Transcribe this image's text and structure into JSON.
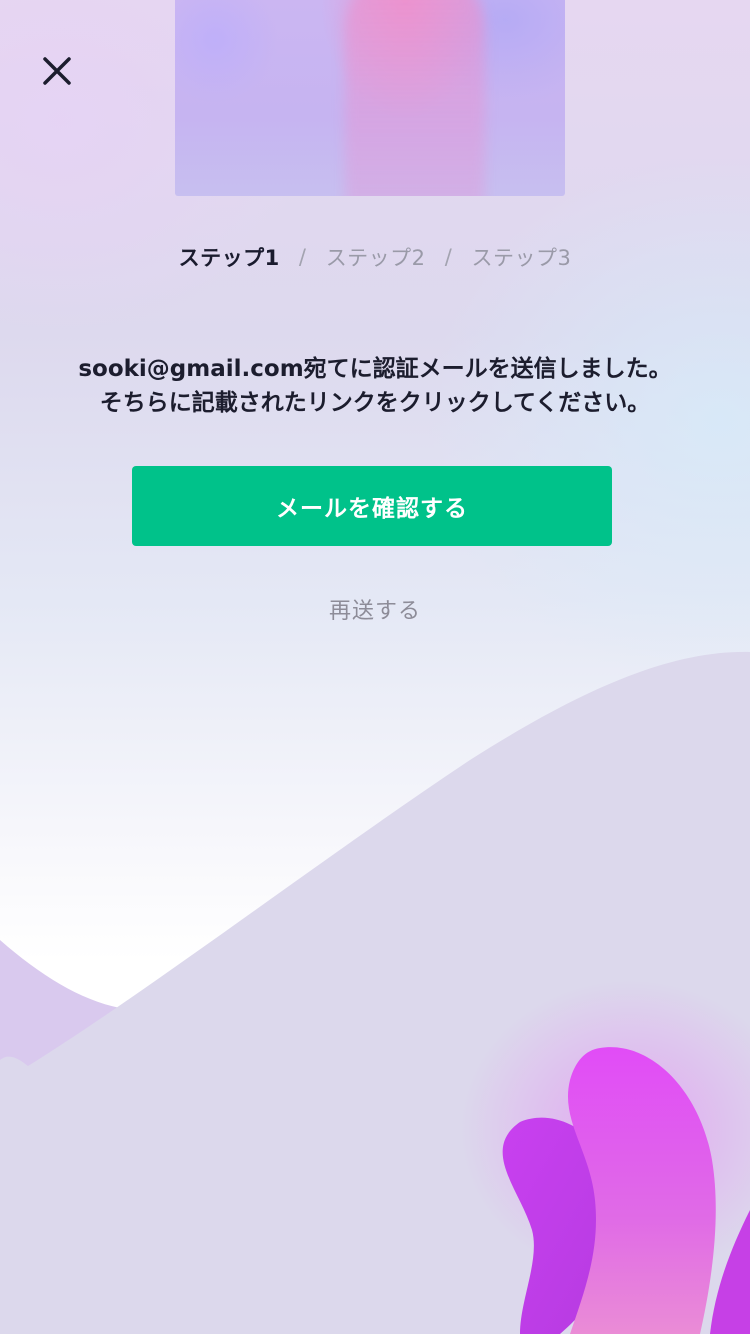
{
  "steps": {
    "step1": "ステップ1",
    "separator1": "/",
    "step2": "ステップ2",
    "separator2": "/",
    "step3": "ステップ3",
    "active_step": 1
  },
  "message": {
    "line1": "sooki@gmail.com宛てに認証メールを送信しました。",
    "line2": "そちらに記載されたリンクをクリックしてください。"
  },
  "buttons": {
    "confirm_label": "メールを確認する",
    "resend_label": "再送する"
  },
  "icons": {
    "close": "close-icon"
  },
  "colors": {
    "accent": "#00c28a",
    "text_primary": "#1c1d2e",
    "text_muted": "#9a9aa8",
    "blob_magenta": "#e050f0",
    "hill": "#dcd8ec"
  }
}
